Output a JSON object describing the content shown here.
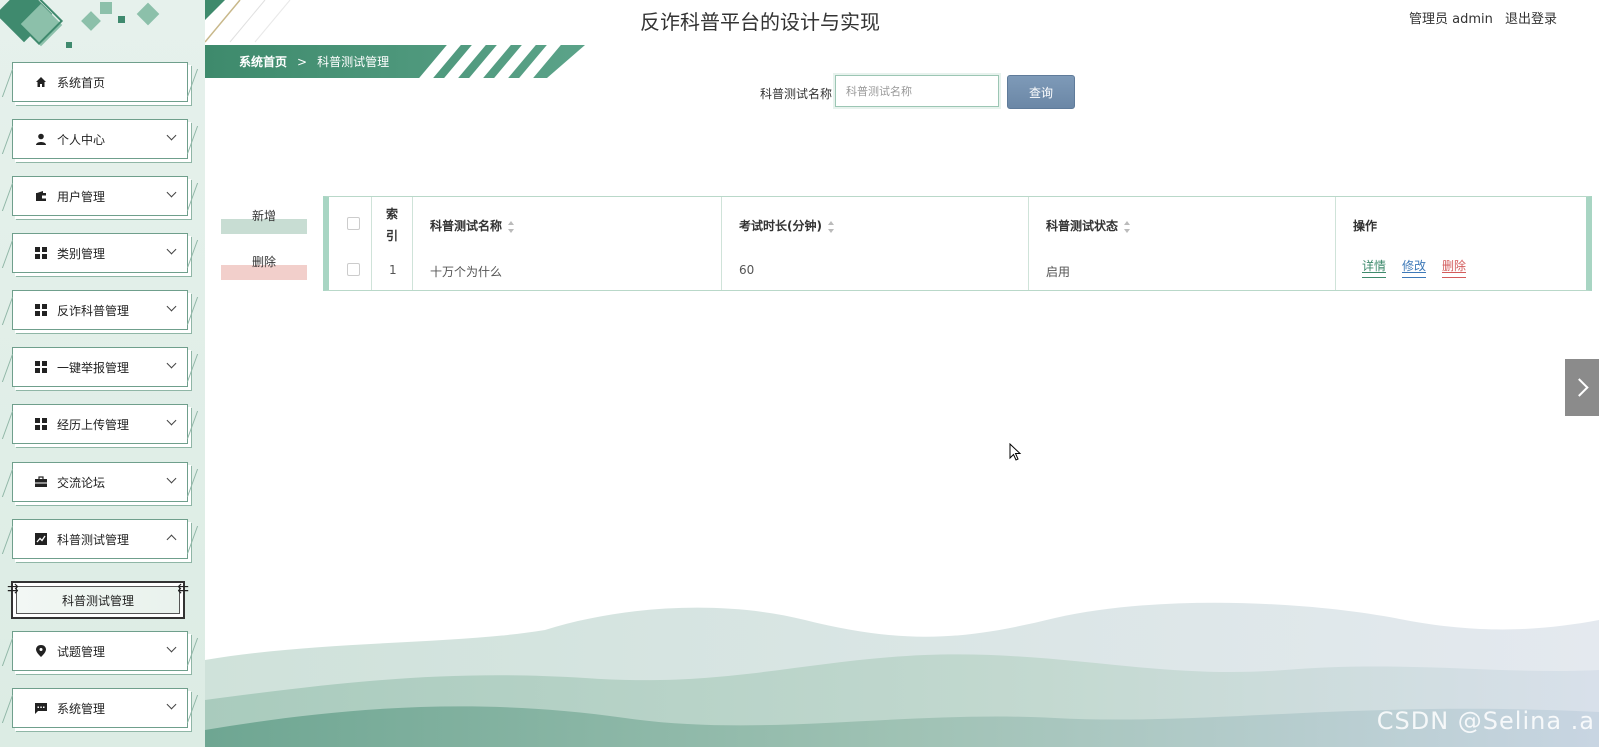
{
  "header": {
    "title": "反诈科普平台的设计与实现",
    "user_role": "管理员 admin",
    "logout": "退出登录"
  },
  "sidebar": {
    "items": [
      {
        "label": "系统首页",
        "icon": "home-icon"
      },
      {
        "label": "个人中心",
        "icon": "user-icon"
      },
      {
        "label": "用户管理",
        "icon": "wallet-icon"
      },
      {
        "label": "类别管理",
        "icon": "grid-icon"
      },
      {
        "label": "反诈科普管理",
        "icon": "grid-icon"
      },
      {
        "label": "一键举报管理",
        "icon": "grid-icon"
      },
      {
        "label": "经历上传管理",
        "icon": "grid-icon"
      },
      {
        "label": "交流论坛",
        "icon": "briefcase-icon"
      },
      {
        "label": "科普测试管理",
        "icon": "chart-icon"
      },
      {
        "label": "试题管理",
        "icon": "pin-icon"
      },
      {
        "label": "系统管理",
        "icon": "message-icon"
      }
    ],
    "sub_item": "科普测试管理"
  },
  "breadcrumb": {
    "home": "系统首页",
    "separator": ">",
    "current": "科普测试管理"
  },
  "search": {
    "label": "科普测试名称",
    "placeholder": "科普测试名称",
    "button": "查询"
  },
  "actions": {
    "add": "新增",
    "delete": "删除"
  },
  "table": {
    "index_header": "索引",
    "columns": [
      "科普测试名称",
      "考试时长(分钟)",
      "科普测试状态",
      "操作"
    ],
    "rows": [
      {
        "index": "1",
        "name": "十万个为什么",
        "duration": "60",
        "status": "启用"
      }
    ],
    "ops": {
      "detail": "详情",
      "edit": "修改",
      "delete": "删除"
    }
  },
  "watermark": "CSDN @Selina .a",
  "colors": {
    "primary_green": "#3e8a6c",
    "button_blue": "#6b87a6",
    "edit_blue": "#3d79b8",
    "delete_red": "#d35b5b"
  }
}
